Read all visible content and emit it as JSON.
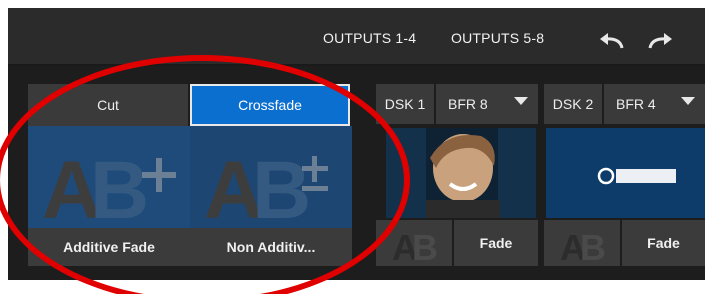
{
  "header": {
    "tabs": [
      "OUTPUTS 1-4",
      "OUTPUTS 5-8"
    ],
    "undo_icon": "undo-icon",
    "redo_icon": "redo-icon"
  },
  "transitions": {
    "left": {
      "header": "Cut",
      "footer": "Additive Fade",
      "symbol": "+"
    },
    "right": {
      "header": "Crossfade",
      "footer": "Non Additiv...",
      "symbol": "±",
      "selected": true
    }
  },
  "dsk": [
    {
      "label": "DSK 1",
      "buffer": "BFR 8",
      "transition": "Fade",
      "preview": "person"
    },
    {
      "label": "DSK 2",
      "buffer": "BFR 4",
      "transition": "Fade",
      "preview": "newtek-logo"
    }
  ],
  "colors": {
    "accent": "#0a6fcf",
    "annotation": "#e00000"
  }
}
